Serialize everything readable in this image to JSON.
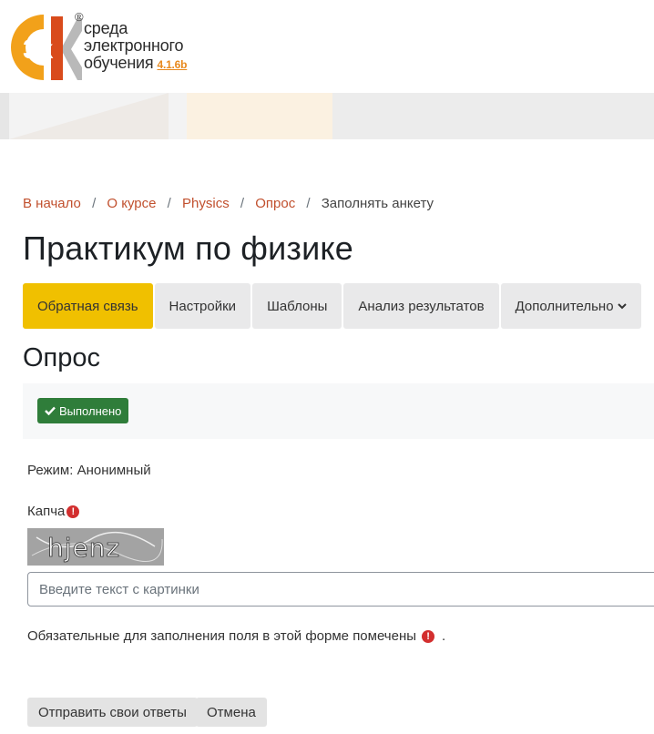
{
  "header": {
    "brand_line1": "среда",
    "brand_line2": "электронного",
    "brand_line3": "обучения",
    "version": "4.1.6b",
    "logo_text": "3k",
    "registered": "®",
    "brand_colors": {
      "orange": "#f2a11a",
      "red": "#d94b1c",
      "gray": "#b9b9b9"
    }
  },
  "breadcrumb": [
    {
      "label": "В начало",
      "link": true
    },
    {
      "label": "О курсе",
      "link": true
    },
    {
      "label": "Physics",
      "link": true
    },
    {
      "label": "Опрос",
      "link": true
    },
    {
      "label": "Заполнять анкету",
      "link": false
    }
  ],
  "breadcrumb_separator": "/",
  "page_title": "Практикум по физике",
  "tabs": [
    {
      "label": "Обратная связь",
      "active": true
    },
    {
      "label": "Настройки",
      "active": false
    },
    {
      "label": "Шаблоны",
      "active": false
    },
    {
      "label": "Анализ результатов",
      "active": false
    },
    {
      "label": "Дополнительно",
      "active": false
    }
  ],
  "activity_title": "Опрос",
  "status_badge": "Выполнено",
  "mode_text": "Режим: Анонимный",
  "captcha": {
    "label": "Капча",
    "image_text": "hjenz",
    "placeholder": "Введите текст с картинки",
    "value": ""
  },
  "required_note": "Обязательные для заполнения поля в этой форме помечены",
  "required_note_end": ".",
  "buttons": {
    "submit": "Отправить свои ответы",
    "cancel": "Отмена"
  },
  "colors": {
    "accent_tab": "#f0c000",
    "link": "#c1502e",
    "success": "#2f7d3a",
    "required": "#d32f2f"
  }
}
